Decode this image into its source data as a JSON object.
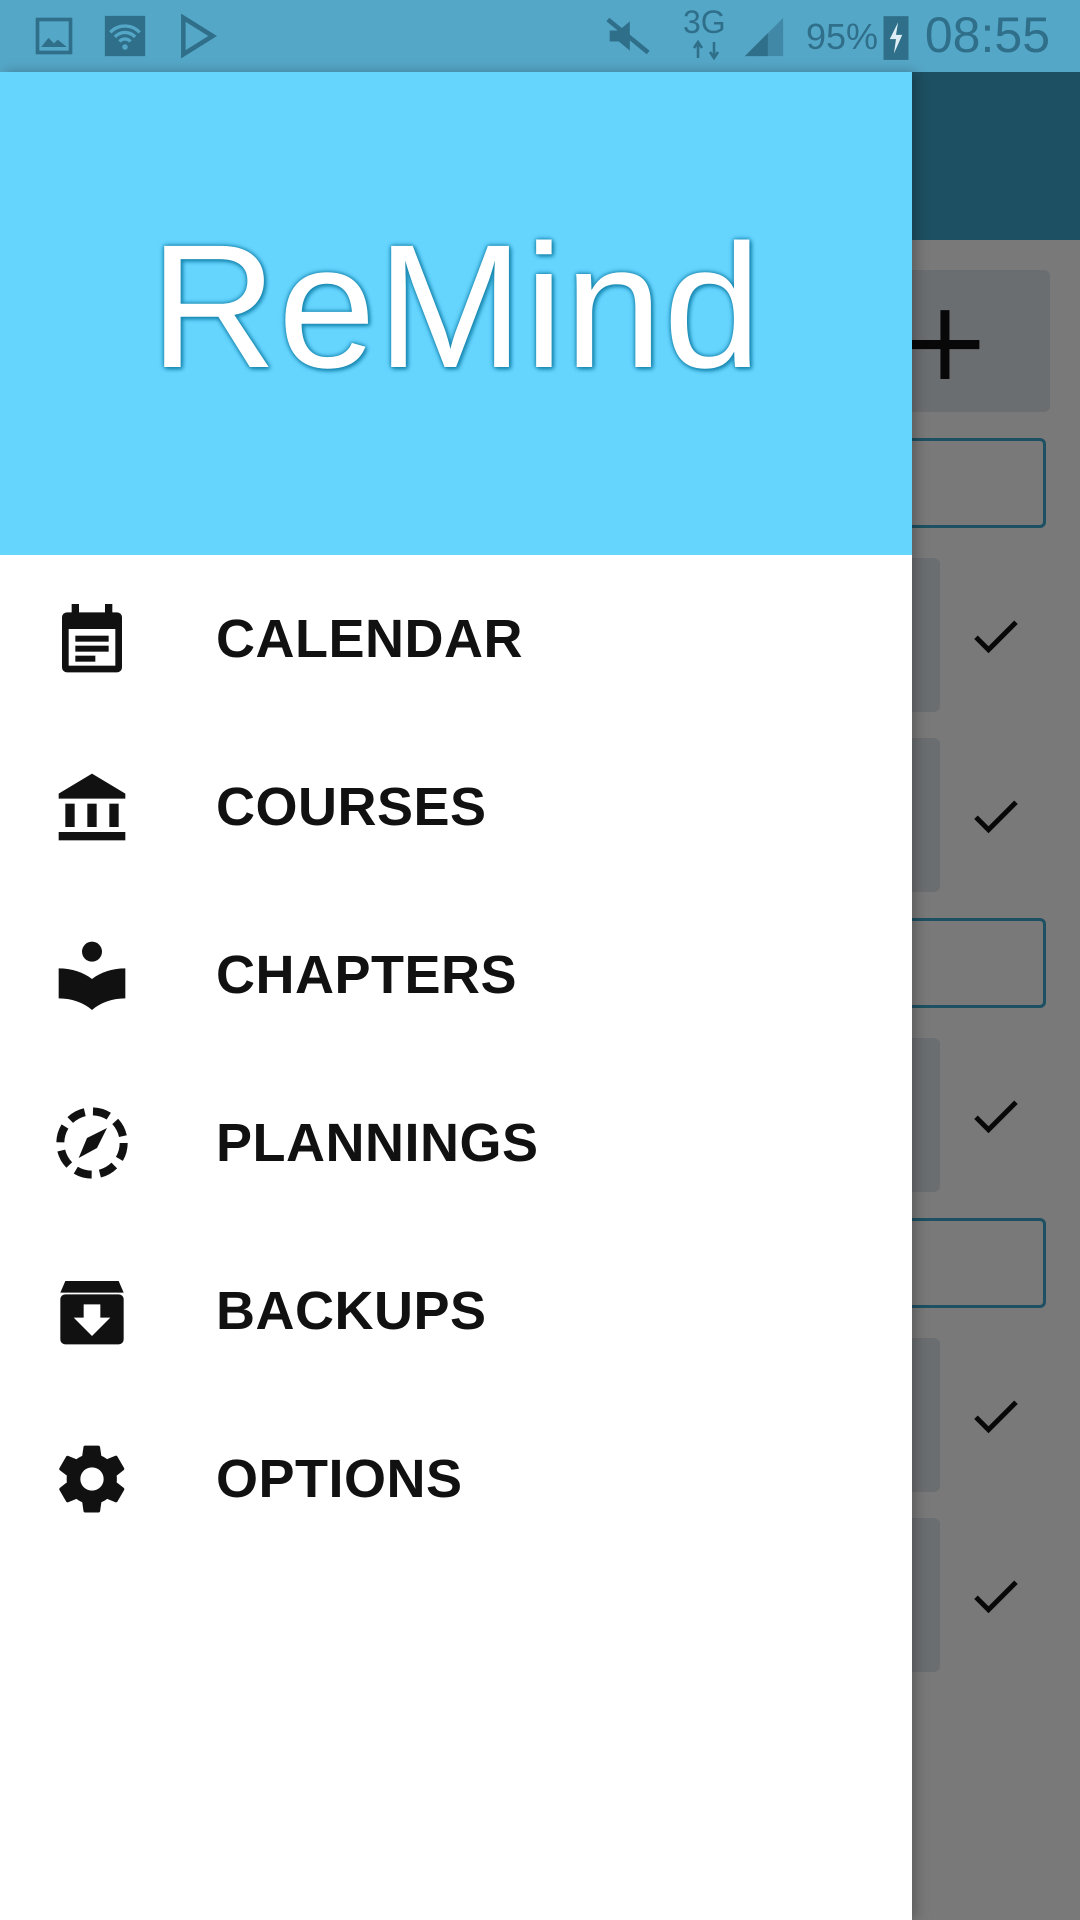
{
  "status_bar": {
    "network": "3G",
    "battery": "95%",
    "time": "08:55"
  },
  "drawer": {
    "brand": "ReMind",
    "items": [
      {
        "label": "CALENDAR",
        "icon": "calendar-icon"
      },
      {
        "label": "COURSES",
        "icon": "courses-icon"
      },
      {
        "label": "CHAPTERS",
        "icon": "chapters-icon"
      },
      {
        "label": "PLANNINGS",
        "icon": "plannings-icon"
      },
      {
        "label": "BACKUPS",
        "icon": "backups-icon"
      },
      {
        "label": "OPTIONS",
        "icon": "gear-icon"
      }
    ]
  },
  "background_app": {
    "add_button": "+"
  },
  "colors": {
    "drawer_header": "#66d5fe",
    "toolbar": "#3aa0c4",
    "status_bar": "#55a7c8"
  }
}
